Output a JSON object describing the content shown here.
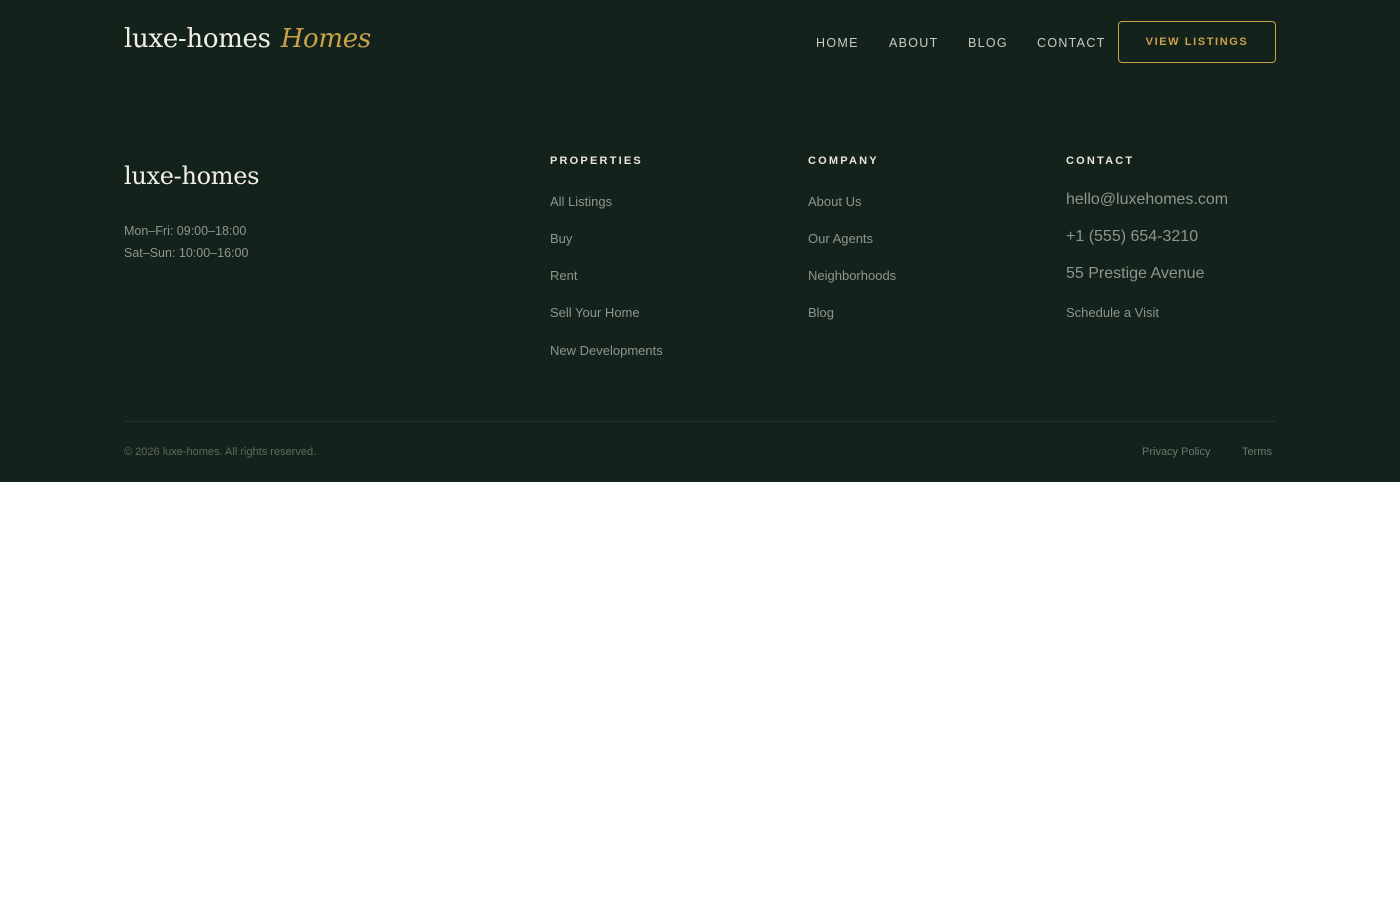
{
  "header": {
    "brand_name": "luxe-homes",
    "brand_accent": "Homes",
    "nav": [
      "HOME",
      "ABOUT",
      "BLOG",
      "CONTACT"
    ],
    "cta_label": "VIEW LISTINGS"
  },
  "footer": {
    "brand_name": "luxe-homes",
    "hours": [
      "Mon–Fri: 09:00–18:00",
      "Sat–Sun: 10:00–16:00"
    ],
    "properties": {
      "heading": "PROPERTIES",
      "links": [
        "All Listings",
        "Buy",
        "Rent",
        "Sell Your Home",
        "New Developments"
      ]
    },
    "company": {
      "heading": "COMPANY",
      "links": [
        "About Us",
        "Our Agents",
        "Neighborhoods",
        "Blog"
      ]
    },
    "contact": {
      "heading": "CONTACT",
      "email": "hello@luxehomes.com",
      "phone": "+1 (555) 654-3210",
      "address": "55 Prestige Avenue",
      "schedule": "Schedule a Visit"
    },
    "copyright": "© 2026 luxe-homes. All rights reserved.",
    "legal": [
      "Privacy Policy",
      "Terms"
    ]
  },
  "colors": {
    "background_dark": "#13221a",
    "accent_gold": "#c9a24a",
    "text_light": "#f1eee6",
    "text_muted": "#8e958f"
  }
}
